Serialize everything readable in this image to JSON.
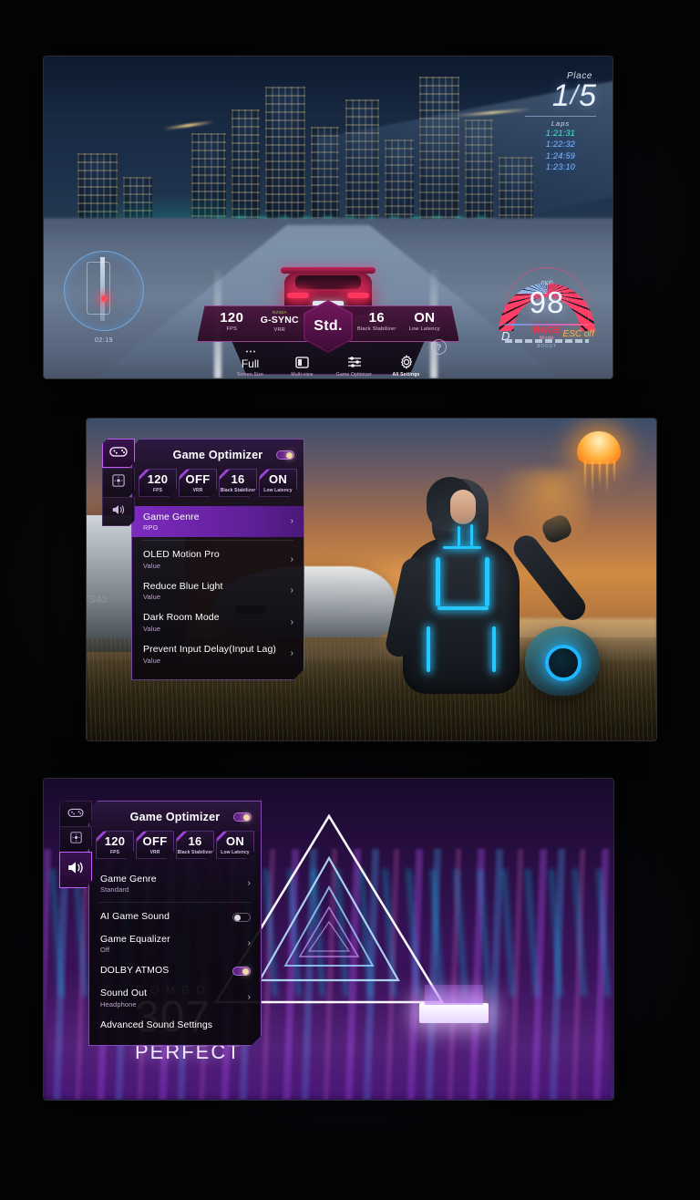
{
  "panels": {
    "racing": {
      "name": "LG TV racing game screen with Game Dashboard",
      "hud": {
        "place_label": "Place",
        "place_current": "1",
        "place_divider": "/",
        "place_total": "5",
        "laps_label": "Laps",
        "lap_times": [
          "1:21:31",
          "1:22:32",
          "1:24:59",
          "1:23:10"
        ],
        "minimap_timer": "02:19"
      },
      "speedometer": {
        "unit": "mph",
        "value": "98",
        "gear": "D",
        "mode_title": "RACE",
        "mode_sub": "Mode",
        "esc": "ESC off",
        "boost_label": "BOOST"
      },
      "game_bar": {
        "stats": [
          {
            "value": "120",
            "label": "FPS"
          },
          {
            "brand": "NVIDIA",
            "value": "G-SYNC",
            "label": "VRR"
          },
          {
            "value": "16",
            "label": "Black Stabilizer"
          },
          {
            "value": "ON",
            "label": "Low Latency"
          }
        ],
        "center_mode": "Std.",
        "arrow_left": "‹",
        "arrow_right": "›",
        "menu": [
          {
            "value": "Full",
            "label": "Screen Size",
            "icon": "dots-icon",
            "active": false
          },
          {
            "value": "",
            "label": "Multi-view",
            "icon": "multiview-icon",
            "active": false
          },
          {
            "value": "",
            "label": "Game Optimizer",
            "icon": "sliders-icon",
            "active": false
          },
          {
            "value": "",
            "label": "All Settings",
            "icon": "gear-icon",
            "active": true
          }
        ],
        "help": "?"
      }
    },
    "scifi": {
      "name": "LG TV sci-fi RPG screen with Game Optimizer picture menu",
      "menu": {
        "title": "Game Optimizer",
        "master_toggle": "on",
        "tabs": [
          {
            "icon": "gamepad-icon",
            "name": "game-tab",
            "active": true
          },
          {
            "icon": "picture-icon",
            "name": "picture-tab",
            "active": false
          },
          {
            "icon": "speaker-icon",
            "name": "sound-tab",
            "active": false
          }
        ],
        "chips": [
          {
            "value": "120",
            "label": "FPS"
          },
          {
            "value": "OFF",
            "label": "VRR"
          },
          {
            "value": "16",
            "label": "Black Stabilizer"
          },
          {
            "value": "ON",
            "label": "Low Latency"
          }
        ],
        "rows": [
          {
            "label": "Game Genre",
            "value": "RPG",
            "control": "chevron",
            "selected": true
          },
          {
            "label": "OLED Motion Pro",
            "value": "Value",
            "control": "chevron",
            "selected": false
          },
          {
            "label": "Reduce Blue Light",
            "value": "Value",
            "control": "chevron",
            "selected": false
          },
          {
            "label": "Dark Room Mode",
            "value": "Value",
            "control": "chevron",
            "selected": false
          },
          {
            "label": "Prevent Input Delay(Input Lag)",
            "value": "Value",
            "control": "chevron",
            "selected": false
          }
        ]
      }
    },
    "rhythm": {
      "name": "LG TV rhythm game screen with Game Optimizer sound menu",
      "menu": {
        "title": "Game Optimizer",
        "master_toggle": "on",
        "tabs": [
          {
            "icon": "gamepad-icon",
            "name": "game-tab",
            "active": false
          },
          {
            "icon": "picture-icon",
            "name": "picture-tab",
            "active": false
          },
          {
            "icon": "speaker-icon",
            "name": "sound-tab",
            "active": true
          }
        ],
        "chips": [
          {
            "value": "120",
            "label": "FPS"
          },
          {
            "value": "OFF",
            "label": "VRR"
          },
          {
            "value": "16",
            "label": "Black Stabilizer"
          },
          {
            "value": "ON",
            "label": "Low Latency"
          }
        ],
        "rows": [
          {
            "label": "Game Genre",
            "value": "Standard",
            "control": "chevron",
            "selected": false
          },
          {
            "label": "AI Game Sound",
            "value": "",
            "control": "toggle-off",
            "selected": false
          },
          {
            "label": "Game Equalizer",
            "value": "Off",
            "control": "chevron",
            "selected": false
          },
          {
            "label": "DOLBY ATMOS",
            "value": "",
            "control": "toggle-on",
            "selected": false
          },
          {
            "label": "Sound Out",
            "value": "Headphone",
            "control": "chevron",
            "selected": false
          },
          {
            "label": "Advanced Sound Settings",
            "value": "",
            "control": "none",
            "selected": false
          }
        ]
      },
      "score": {
        "combo_label": "COMBO",
        "combo_value": "307",
        "judgement": "PERFECT"
      }
    }
  },
  "colors": {
    "accent_purple": "#c45cff",
    "accent_magenta": "#f05ad2",
    "selected_row": "#7c2bbe",
    "race_red": "#ff2e49",
    "esc_amber": "#ffb347",
    "best_lap_green": "#3ff0c0"
  }
}
